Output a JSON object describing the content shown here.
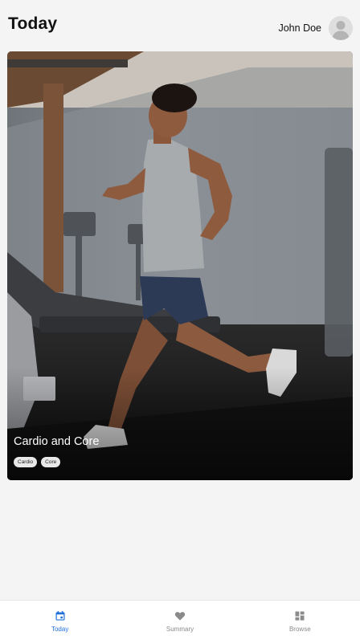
{
  "header": {
    "title": "Today",
    "user_name": "John Doe"
  },
  "workout_card": {
    "title": "Cardio and Core",
    "tags": [
      "Cardio",
      "Core"
    ]
  },
  "tabbar": {
    "items": [
      {
        "label": "Today",
        "icon": "calendar-icon",
        "active": true
      },
      {
        "label": "Summary",
        "icon": "heart-icon",
        "active": false
      },
      {
        "label": "Browse",
        "icon": "grid-icon",
        "active": false
      }
    ]
  },
  "colors": {
    "accent": "#1e6fd9",
    "inactive": "#8a8a8a",
    "background": "#f4f4f4"
  }
}
